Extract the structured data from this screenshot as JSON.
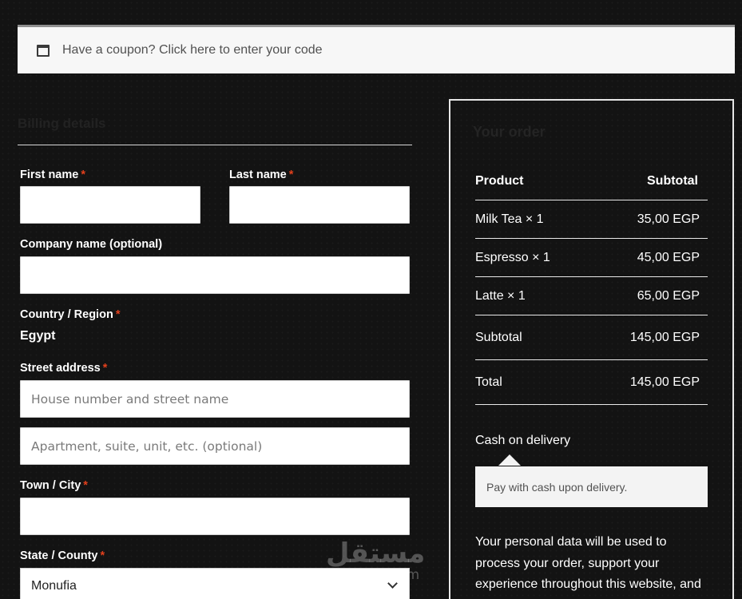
{
  "coupon": {
    "text": "Have a coupon? Click here to enter your code"
  },
  "billing": {
    "heading": "Billing details",
    "first_name_label": "First name",
    "last_name_label": "Last name",
    "company_label": "Company name (optional)",
    "country_label": "Country / Region",
    "country_value": "Egypt",
    "street_label": "Street address",
    "street1_placeholder": "House number and street name",
    "street2_placeholder": "Apartment, suite, unit, etc. (optional)",
    "town_label": "Town / City",
    "state_label": "State / County",
    "state_value": "Monufia",
    "required_mark": "*"
  },
  "order": {
    "heading": "Your order",
    "product_header": "Product",
    "subtotal_header": "Subtotal",
    "items": [
      {
        "name": "Milk Tea × 1",
        "price": "35,00 EGP"
      },
      {
        "name": "Espresso × 1",
        "price": "45,00 EGP"
      },
      {
        "name": "Latte × 1",
        "price": "65,00 EGP"
      }
    ],
    "subtotal_label": "Subtotal",
    "subtotal_value": "145,00 EGP",
    "total_label": "Total",
    "total_value": "145,00 EGP",
    "payment_method": "Cash on delivery",
    "payment_description": "Pay with cash upon delivery.",
    "privacy_text": "Your personal data will be used to process your order, support your experience throughout this website, and"
  },
  "watermark": {
    "arabic": "مستقل",
    "latin": "mostaql.com"
  },
  "colors": {
    "background": "#131313",
    "required": "#e2401c",
    "notice_bg": "#f7f7f7"
  }
}
